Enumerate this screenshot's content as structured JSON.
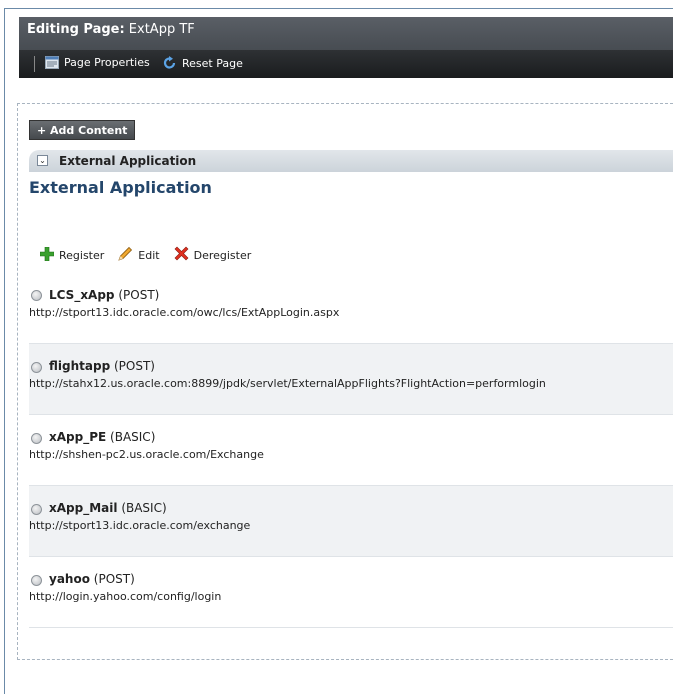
{
  "header": {
    "title_prefix": "Editing Page:",
    "title_name": " ExtApp TF",
    "page_properties": "Page Properties",
    "reset_page": "Reset Page"
  },
  "toolbar": {
    "add_content": "+ Add Content"
  },
  "panel": {
    "title": "External Application",
    "heading": "External Application"
  },
  "actions": {
    "register": "Register",
    "edit": "Edit",
    "deregister": "Deregister"
  },
  "apps": [
    {
      "name": "LCS_xApp",
      "method": "(POST)",
      "url": "http://stport13.idc.oracle.com/owc/lcs/ExtAppLogin.aspx"
    },
    {
      "name": "flightapp",
      "method": "(POST)",
      "url": "http://stahx12.us.oracle.com:8899/jpdk/servlet/ExternalAppFlights?FlightAction=performlogin"
    },
    {
      "name": "xApp_PE",
      "method": "(BASIC)",
      "url": "http://shshen-pc2.us.oracle.com/Exchange"
    },
    {
      "name": "xApp_Mail",
      "method": "(BASIC)",
      "url": "http://stport13.idc.oracle.com/exchange"
    },
    {
      "name": "yahoo",
      "method": "(POST)",
      "url": "http://login.yahoo.com/config/login"
    }
  ],
  "colors": {
    "header_bg": "#4a4f55",
    "toolbar_bg": "#1f2124",
    "heading_blue": "#24466b",
    "alt_row": "#f0f2f4"
  }
}
